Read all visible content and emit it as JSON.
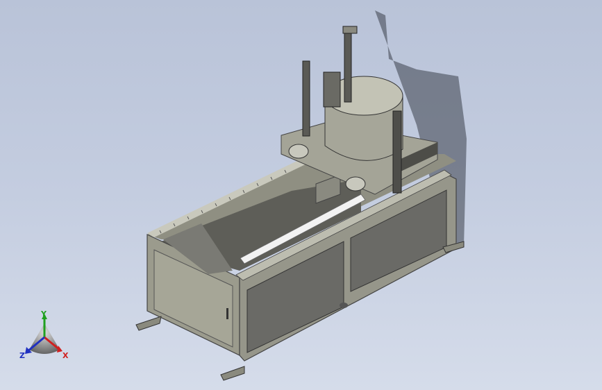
{
  "viewport": {
    "background_top": "#b9c3d8",
    "background_bottom": "#d5dcea"
  },
  "model": {
    "frame_color": "#9a9a8c",
    "panel_color": "#6e6e6a",
    "rail_color": "#e8e8e8",
    "drum_color": "#a8a89a"
  },
  "triad": {
    "x_label": "X",
    "y_label": "Y",
    "z_label": "Z",
    "x_color": "#d02020",
    "y_color": "#20a020",
    "z_color": "#2030c0"
  }
}
